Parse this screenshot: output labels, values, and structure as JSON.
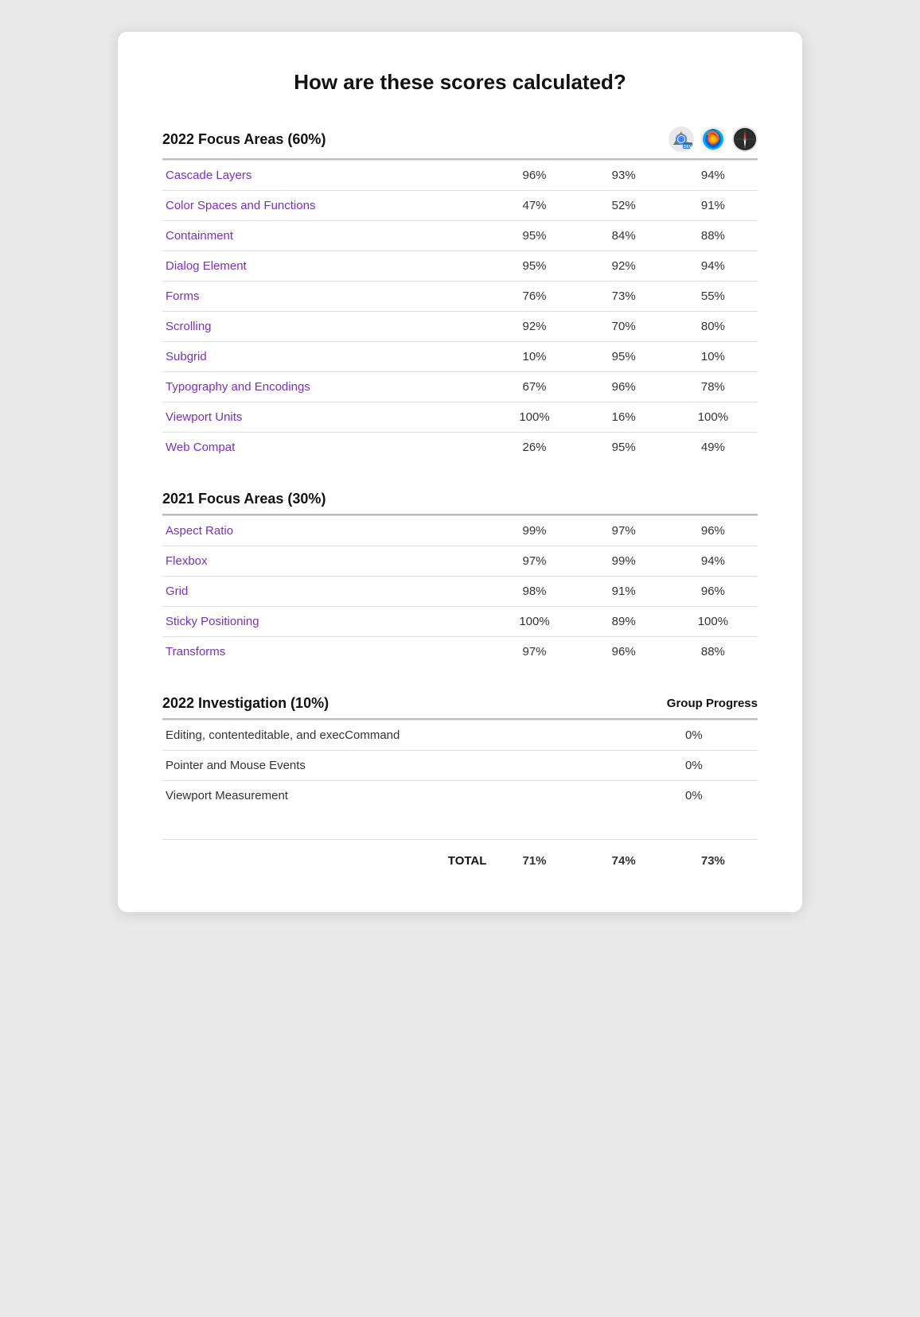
{
  "page": {
    "title": "How are these scores calculated?",
    "card": {
      "section2022": {
        "heading": "2022 Focus Areas (60%)",
        "browsers": [
          {
            "name": "chrome-dev",
            "label": "Chrome Dev"
          },
          {
            "name": "firefox",
            "label": "Firefox"
          },
          {
            "name": "safari",
            "label": "Safari"
          }
        ],
        "rows": [
          {
            "label": "Cascade Layers",
            "scores": [
              "96%",
              "93%",
              "94%"
            ],
            "linked": true
          },
          {
            "label": "Color Spaces and Functions",
            "scores": [
              "47%",
              "52%",
              "91%"
            ],
            "linked": true
          },
          {
            "label": "Containment",
            "scores": [
              "95%",
              "84%",
              "88%"
            ],
            "linked": true
          },
          {
            "label": "Dialog Element",
            "scores": [
              "95%",
              "92%",
              "94%"
            ],
            "linked": true
          },
          {
            "label": "Forms",
            "scores": [
              "76%",
              "73%",
              "55%"
            ],
            "linked": true
          },
          {
            "label": "Scrolling",
            "scores": [
              "92%",
              "70%",
              "80%"
            ],
            "linked": true
          },
          {
            "label": "Subgrid",
            "scores": [
              "10%",
              "95%",
              "10%"
            ],
            "linked": true
          },
          {
            "label": "Typography and Encodings",
            "scores": [
              "67%",
              "96%",
              "78%"
            ],
            "linked": true
          },
          {
            "label": "Viewport Units",
            "scores": [
              "100%",
              "16%",
              "100%"
            ],
            "linked": true
          },
          {
            "label": "Web Compat",
            "scores": [
              "26%",
              "95%",
              "49%"
            ],
            "linked": true
          }
        ]
      },
      "section2021": {
        "heading": "2021 Focus Areas (30%)",
        "rows": [
          {
            "label": "Aspect Ratio",
            "scores": [
              "99%",
              "97%",
              "96%"
            ],
            "linked": true
          },
          {
            "label": "Flexbox",
            "scores": [
              "97%",
              "99%",
              "94%"
            ],
            "linked": true
          },
          {
            "label": "Grid",
            "scores": [
              "98%",
              "91%",
              "96%"
            ],
            "linked": true
          },
          {
            "label": "Sticky Positioning",
            "scores": [
              "100%",
              "89%",
              "100%"
            ],
            "linked": true
          },
          {
            "label": "Transforms",
            "scores": [
              "97%",
              "96%",
              "88%"
            ],
            "linked": true
          }
        ]
      },
      "sectionInvestigation": {
        "heading": "2022 Investigation (10%)",
        "groupProgressLabel": "Group Progress",
        "rows": [
          {
            "label": "Editing, contenteditable, and execCommand",
            "score": "0%"
          },
          {
            "label": "Pointer and Mouse Events",
            "score": "0%"
          },
          {
            "label": "Viewport Measurement",
            "score": "0%"
          }
        ]
      },
      "totalRow": {
        "label": "TOTAL",
        "scores": [
          "71%",
          "74%",
          "73%"
        ]
      }
    }
  }
}
